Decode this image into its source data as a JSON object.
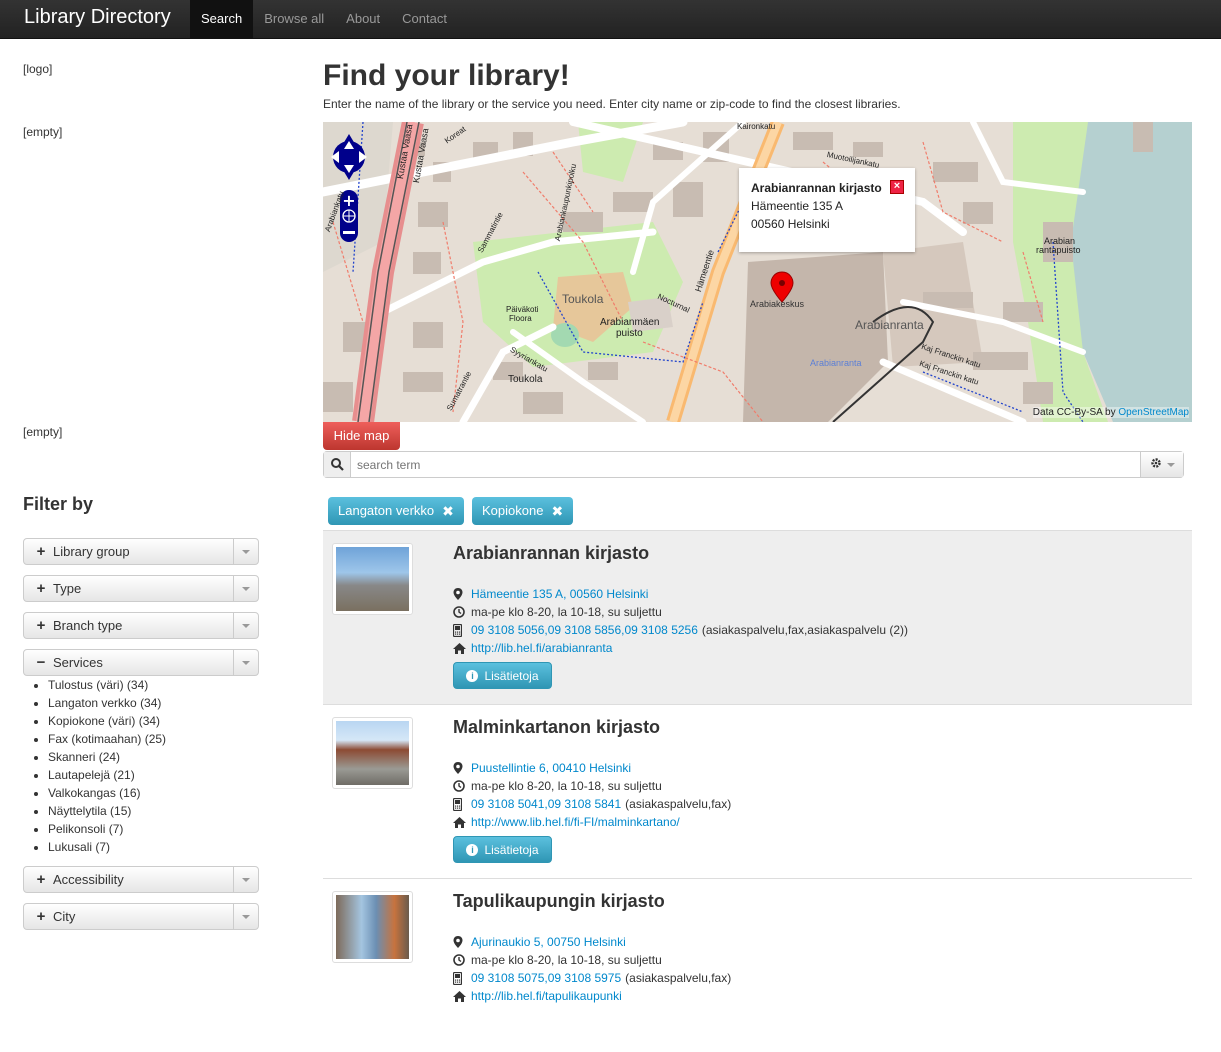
{
  "navbar": {
    "brand": "Library Directory",
    "items": [
      {
        "label": "Search",
        "active": true
      },
      {
        "label": "Browse all",
        "active": false
      },
      {
        "label": "About",
        "active": false
      },
      {
        "label": "Contact",
        "active": false
      }
    ]
  },
  "sidebar": {
    "logo_placeholder": "[logo]",
    "empty_1": "[empty]",
    "empty_2": "[empty]",
    "filter_title": "Filter by",
    "filters": {
      "library_group": "Library group",
      "type": "Type",
      "branch_type": "Branch type",
      "services": "Services",
      "accessibility": "Accessibility",
      "city": "City"
    },
    "services_list": [
      "Tulostus (väri) (34)",
      "Langaton verkko (34)",
      "Kopiokone (väri) (34)",
      "Fax (kotimaahan) (25)",
      "Skanneri (24)",
      "Lautapelejä (21)",
      "Valkokangas (16)",
      "Näyttelytila (15)",
      "Pelikonsoli (7)",
      "Lukusali (7)"
    ]
  },
  "main": {
    "title": "Find your library!",
    "subtitle": "Enter the name of the library or the service you need. Enter city name or zip-code to find the closest libraries.",
    "map": {
      "popup_title": "Arabianrannan kirjasto",
      "popup_street": "Hämeentie 135 A",
      "popup_city": "00560 Helsinki",
      "attribution_prefix": "Data CC-By-SA by",
      "attribution_link": "OpenStreetMap",
      "labels": {
        "toukola": "Toukola",
        "toukola2": "Toukola",
        "arabianmaen_1": "Arabianmäen",
        "arabianmaen_2": "puisto",
        "paivakoti_1": "Päiväkoti",
        "paivakoti_2": "Floora",
        "arabiakeskus": "Arabiakeskus",
        "arabianranta": "Arabianranta",
        "arabianranta_small": "Arabianranta",
        "rantapuisto_1": "Arabian",
        "rantapuisto_2": "rantapuisto",
        "hameentie": "Hämeentie",
        "kustaa_1": "Kustaa Vaasa",
        "kustaa_2": "Kustaa Vaasa",
        "koreat": "Koreat",
        "nocturnal": "Nocturnal",
        "sumatrantie": "Sumatrantie",
        "syyriankatu": "Syyriankatu",
        "kaj_1": "Kaj Franckin katu",
        "kaj_2": "Kaj Franckin katu",
        "muotoilijankatu": "Muotoilijankatu",
        "kaironkatu": "Kaironkatu",
        "arabianpolku": "Arabiankaupunkipolku",
        "samrantie": "Sammatintie",
        "arabiankatu": "Arabiankatu",
        "hpuisto": "puisto"
      }
    },
    "hide_map_label": "Hide map",
    "search_placeholder": "search term",
    "active_tags": [
      "Langaton verkko",
      "Kopiokone"
    ],
    "more_info_label": "Lisätietoja",
    "results": [
      {
        "name": "Arabianrannan kirjasto",
        "address": "Hämeentie 135 A, 00560 Helsinki",
        "hours": "ma-pe klo 8-20, la 10-18, su suljettu",
        "phones": "09 3108 5056,09 3108 5856,09 3108 5256",
        "phone_notes": "(asiakaspalvelu,fax,asiakaspalvelu (2))",
        "url": "http://lib.hel.fi/arabianranta"
      },
      {
        "name": "Malminkartanon kirjasto",
        "address": "Puustellintie 6, 00410 Helsinki",
        "hours": "ma-pe klo 8-20, la 10-18, su suljettu",
        "phones": "09 3108 5041,09 3108 5841",
        "phone_notes": "(asiakaspalvelu,fax)",
        "url": "http://www.lib.hel.fi/fi-FI/malminkartano/"
      },
      {
        "name": "Tapulikaupungin kirjasto",
        "address": "Ajurinaukio 5, 00750 Helsinki",
        "hours": "ma-pe klo 8-20, la 10-18, su suljettu",
        "phones": "09 3108 5075,09 3108 5975",
        "phone_notes": "(asiakaspalvelu,fax)",
        "url": "http://lib.hel.fi/tapulikaupunki"
      }
    ]
  },
  "colors": {
    "primary": "#0088cc",
    "danger": "#da4f49",
    "info": "#49afcd",
    "navbar": "#222222"
  }
}
